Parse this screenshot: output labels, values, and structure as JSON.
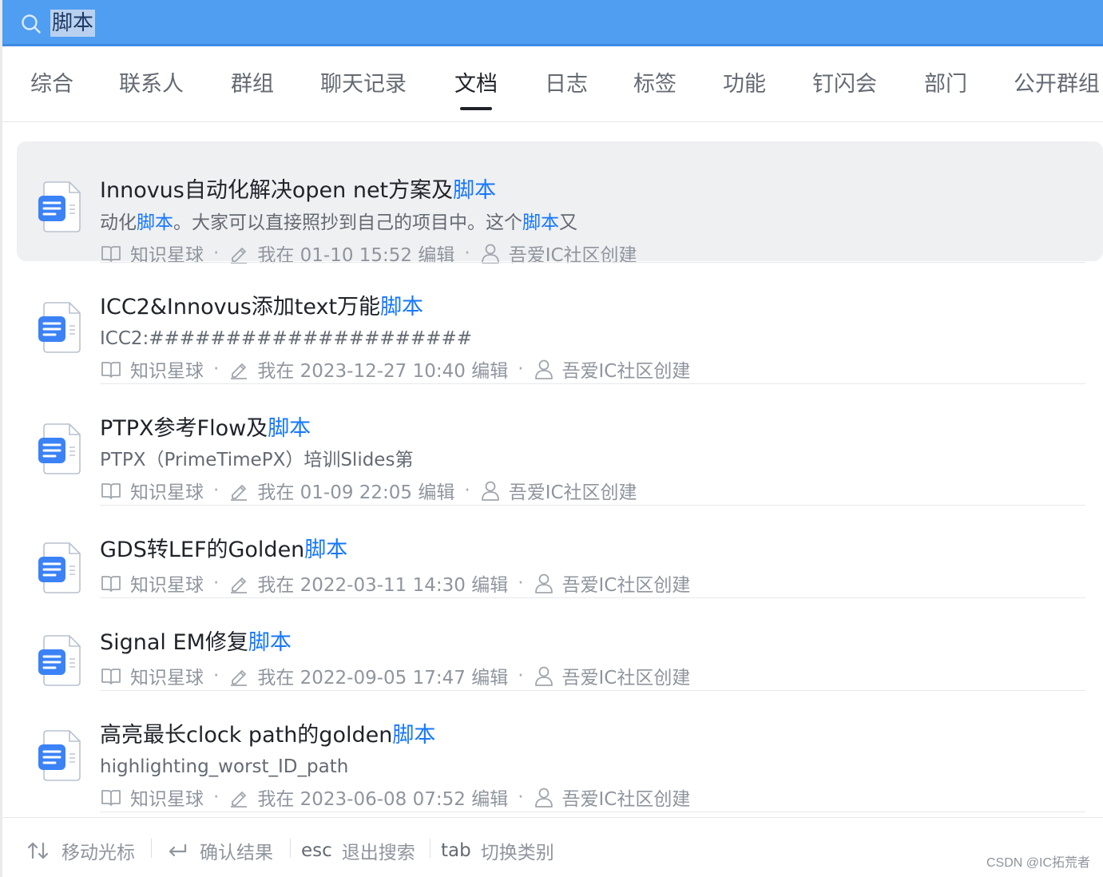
{
  "search": {
    "query": "脚本"
  },
  "tabs": [
    {
      "label": "综合",
      "active": false
    },
    {
      "label": "联系人",
      "active": false
    },
    {
      "label": "群组",
      "active": false
    },
    {
      "label": "聊天记录",
      "active": false
    },
    {
      "label": "文档",
      "active": true
    },
    {
      "label": "日志",
      "active": false
    },
    {
      "label": "标签",
      "active": false
    },
    {
      "label": "功能",
      "active": false
    },
    {
      "label": "钉闪会",
      "active": false
    },
    {
      "label": "部门",
      "active": false
    },
    {
      "label": "公开群组",
      "active": false
    }
  ],
  "results": [
    {
      "title_prefix": "Innovus自动化解决open net方案及",
      "title_hl": "脚本",
      "title_suffix": "",
      "snippet": [
        {
          "text": "动化",
          "hl": false
        },
        {
          "text": "脚本",
          "hl": true
        },
        {
          "text": "。大家可以直接照抄到自己的项目中。这个",
          "hl": false
        },
        {
          "text": "脚本",
          "hl": true
        },
        {
          "text": "又",
          "hl": false
        }
      ],
      "space": "知识星球",
      "edited": "我在 01-10 15:52 编辑",
      "creator": "吾爱IC社区创建",
      "selected": true
    },
    {
      "title_prefix": "ICC2&Innovus添加text万能",
      "title_hl": "脚本",
      "title_suffix": "",
      "snippet": [
        {
          "text": "ICC2:#####################",
          "hl": false
        }
      ],
      "space": "知识星球",
      "edited": "我在 2023-12-27 10:40 编辑",
      "creator": "吾爱IC社区创建",
      "selected": false
    },
    {
      "title_prefix": "PTPX参考Flow及",
      "title_hl": "脚本",
      "title_suffix": "",
      "snippet": [
        {
          "text": "PTPX（PrimeTimePX）培训Slides第",
          "hl": false
        }
      ],
      "space": "知识星球",
      "edited": "我在 01-09 22:05 编辑",
      "creator": "吾爱IC社区创建",
      "selected": false
    },
    {
      "title_prefix": "GDS转LEF的Golden",
      "title_hl": "脚本",
      "title_suffix": "",
      "snippet": [],
      "space": "知识星球",
      "edited": "我在 2022-03-11 14:30 编辑",
      "creator": "吾爱IC社区创建",
      "selected": false
    },
    {
      "title_prefix": "Signal EM修复",
      "title_hl": "脚本",
      "title_suffix": "",
      "snippet": [],
      "space": "知识星球",
      "edited": "我在 2022-09-05 17:47 编辑",
      "creator": "吾爱IC社区创建",
      "selected": false
    },
    {
      "title_prefix": "高亮最长clock path的golden",
      "title_hl": "脚本",
      "title_suffix": "",
      "snippet": [
        {
          "text": "highlighting_worst_ID_path",
          "hl": false
        }
      ],
      "space": "知识星球",
      "edited": "我在 2023-06-08 07:52 编辑",
      "creator": "吾爱IC社区创建",
      "selected": false
    }
  ],
  "footer": {
    "hints": [
      {
        "key": "",
        "icon": "up-down-arrows-icon",
        "label": "移动光标"
      },
      {
        "key": "",
        "icon": "enter-icon",
        "label": "确认结果"
      },
      {
        "key": "esc",
        "icon": "",
        "label": "退出搜索"
      },
      {
        "key": "tab",
        "icon": "",
        "label": "切换类别"
      }
    ],
    "watermark": "CSDN @IC拓荒者"
  },
  "colors": {
    "search_bar": "#4f9ef2",
    "highlight": "#1677ff",
    "selected_row": "#eff0f2"
  }
}
